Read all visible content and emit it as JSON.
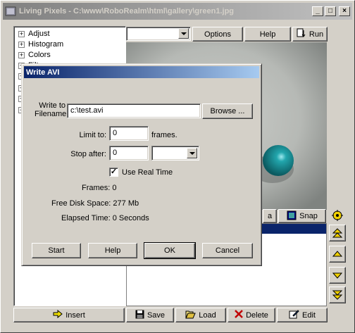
{
  "main_window": {
    "title": "Living Pixels - C:\\www\\RoboRealm\\html\\gallery\\green1.jpg",
    "minimize_glyph": "_",
    "maximize_glyph": "□",
    "close_glyph": "×"
  },
  "toolbar": {
    "combo_value": "",
    "options_label": "Options",
    "help_label": "Help",
    "run_label": "Run"
  },
  "tree": {
    "items": [
      {
        "label": "Adjust"
      },
      {
        "label": "Histogram"
      },
      {
        "label": "Colors"
      },
      {
        "label": "Filt..."
      },
      {
        "label": ""
      },
      {
        "label": ""
      },
      {
        "label": ""
      }
    ]
  },
  "image_toolbar": {
    "partial_label": "a",
    "snap_label": "Snap"
  },
  "bottom_bar": {
    "insert_label": "Insert",
    "save_label": "Save",
    "load_label": "Load",
    "delete_label": "Delete",
    "edit_label": "Edit"
  },
  "dialog": {
    "title": "Write AVI",
    "write_to_label_line1": "Write to",
    "write_to_label_line2": "Filename:",
    "filename_value": "c:\\test.avi",
    "browse_label": "Browse ...",
    "limit_label": "Limit to:",
    "limit_value": "0",
    "frames_unit": "frames.",
    "stop_after_label": "Stop after:",
    "stop_after_value": "0",
    "stop_after_unit": "",
    "use_real_time_label": "Use Real Time",
    "use_real_time_checked": true,
    "frames_stat_label": "Frames: 0",
    "free_disk_label": "Free Disk Space: 277 Mb",
    "elapsed_label": "Elapsed Time: 0 Seconds",
    "start_label": "Start",
    "help_label": "Help",
    "ok_label": "OK",
    "cancel_label": "Cancel"
  },
  "colors": {
    "title_active": "#0a246a",
    "ball": "#127f86",
    "face": "#d4d0c8"
  }
}
